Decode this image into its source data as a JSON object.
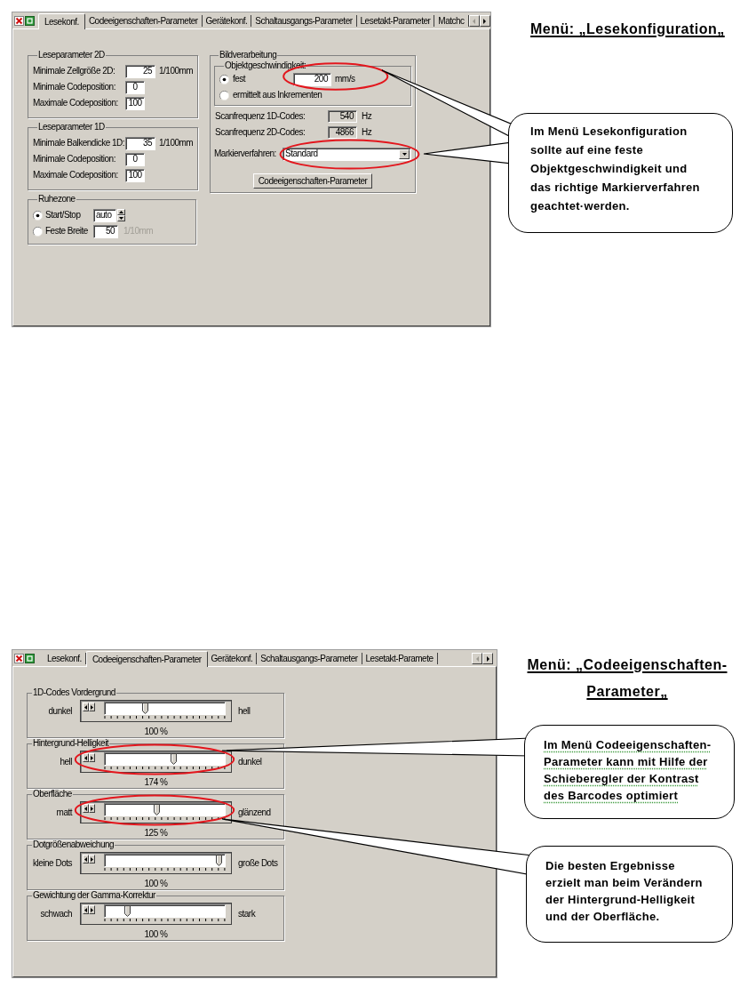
{
  "top_dialog": {
    "tabs": [
      {
        "label": "Lesekonf.",
        "selected": true
      },
      {
        "label": "Codeeigenschaften-Parameter",
        "selected": false
      },
      {
        "label": "Gerätekonf.",
        "selected": false
      },
      {
        "label": "Schaltausgangs-Parameter",
        "selected": false
      },
      {
        "label": "Lesetakt-Parameter",
        "selected": false
      },
      {
        "label": "Matchc",
        "selected": false
      }
    ],
    "tab_scroll": {
      "back_disabled": true
    },
    "reading_groups": [
      {
        "title": "Leseparameter 2D",
        "fields": [
          {
            "label": "Minimale Zellgröße 2D:",
            "value": "25",
            "unit": "1/100mm"
          },
          {
            "label": "Minimale Codeposition:",
            "value": "0"
          },
          {
            "label": "Maximale Codeposition:",
            "value": "100"
          }
        ]
      },
      {
        "title": "Leseparameter 1D",
        "fields": [
          {
            "label": "Minimale Balkendicke 1D:",
            "value": "35",
            "unit": "1/100mm"
          },
          {
            "label": "Minimale Codeposition:",
            "value": "0"
          },
          {
            "label": "Maximale Codeposition:",
            "value": "100"
          }
        ]
      }
    ],
    "quiet_zone": {
      "title": "Ruhezone",
      "options": [
        {
          "label": "Start/Stop",
          "selected": true,
          "kind": "spin",
          "value": "auto"
        },
        {
          "label": "Feste Breite",
          "selected": false,
          "kind": "text",
          "value": "50",
          "unit": "1/10mm"
        }
      ]
    },
    "image_processing": {
      "title": "Bildverarbeitung",
      "speed": {
        "title": "Objektgeschwindigkeit:",
        "options": [
          {
            "label": "fest",
            "selected": true,
            "value": "200",
            "unit": "mm/s",
            "highlighted": true
          },
          {
            "label": "ermittelt aus Inkrementen",
            "selected": false,
            "highlighted": false
          }
        ]
      },
      "readouts": [
        {
          "label": "Scanfrequenz 1D-Codes:",
          "value": "540",
          "unit": "Hz"
        },
        {
          "label": "Scanfrequenz 2D-Codes:",
          "value": "4866",
          "unit": "Hz"
        }
      ],
      "method": {
        "label": "Markierverfahren:",
        "value": "Standard",
        "highlighted": true
      },
      "button": "Codeeigenschaften-Parameter"
    }
  },
  "top_heading": {
    "lines": [
      "Menü: „Lesekonfiguration„"
    ]
  },
  "top_callout": {
    "lines": [
      "Im Menü Lesekonfiguration",
      "sollte auf eine feste",
      "Objektgeschwindigkeit und",
      "das richtige Markierverfahren",
      "geachtet·werden."
    ]
  },
  "bottom_dialog": {
    "tabs": [
      {
        "label": "Lesekonf.",
        "selected": false
      },
      {
        "label": "Codeeigenschaften-Parameter",
        "selected": true
      },
      {
        "label": "Gerätekonf.",
        "selected": false
      },
      {
        "label": "Schaltausgangs-Parameter",
        "selected": false
      },
      {
        "label": "Lesetakt-Paramete",
        "selected": false
      }
    ],
    "tab_scroll": {
      "back_disabled": true
    },
    "sliders": [
      {
        "title": "1D-Codes Vordergrund",
        "left": "dunkel",
        "right": "hell",
        "level": 0.33,
        "reading": "100 %",
        "highlighted": false
      },
      {
        "title": "Hintergrund-Helligkeit",
        "left": "hell",
        "right": "dunkel",
        "level": 0.58,
        "reading": "174 %",
        "highlighted": true
      },
      {
        "title": "Oberfläche",
        "left": "matt",
        "right": "glänzend",
        "level": 0.43,
        "reading": "125 %",
        "highlighted": true
      },
      {
        "title": "Dotgrößenabweichung",
        "left": "kleine Dots",
        "right": "große Dots",
        "level": 0.98,
        "reading": "100 %",
        "highlighted": false
      },
      {
        "title": "Gewichtung der Gamma-Korrektur",
        "left": "schwach",
        "right": "stark",
        "level": 0.17,
        "reading": "100 %",
        "highlighted": false
      }
    ]
  },
  "bottom_heading": {
    "lines": [
      "Menü: „Codeeigenschaften-",
      "Parameter„"
    ]
  },
  "bottom_callouts": [
    {
      "lines": [
        "Im Menü Codeeigenschaften-",
        "Parameter kann mit Hilfe der",
        "Schieberegler der Kontrast",
        "des Barcodes optimiert"
      ],
      "grammar_marked": true
    },
    {
      "lines": [
        "Die besten Ergebnisse",
        "erzielt man beim Verändern",
        "der Hintergrund-Helligkeit",
        "und der Oberfläche."
      ],
      "grammar_marked": false
    }
  ]
}
